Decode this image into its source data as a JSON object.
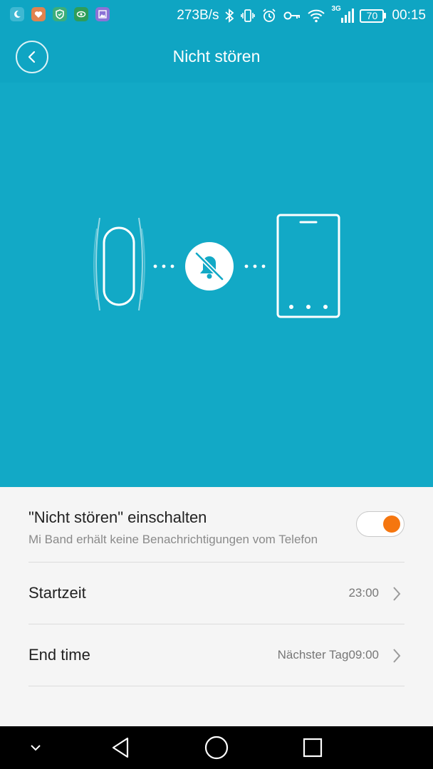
{
  "status_bar": {
    "apps": [
      {
        "icon": "moon-app-icon",
        "color": "#3fb8d2"
      },
      {
        "icon": "heart-app-icon",
        "color": "#e0834f"
      },
      {
        "icon": "shield-app-icon",
        "color": "#3cae7a"
      },
      {
        "icon": "eye-app-icon",
        "color": "#2e9d59"
      },
      {
        "icon": "image-app-icon",
        "color": "#8b72d6"
      }
    ],
    "net_speed": "273B/s",
    "network_type": "3G",
    "battery": "70",
    "time": "00:15"
  },
  "header": {
    "title": "Nicht stören",
    "back_icon": "chevron-left-icon",
    "color": "#0fa5c3"
  },
  "hero": {
    "color": "#12a9c6",
    "icons": [
      "band-icon",
      "bell-off-icon",
      "phone-icon"
    ]
  },
  "settings": {
    "dnd_toggle": {
      "title": "\"Nicht stören\" einschalten",
      "subtitle": "Mi Band erhält keine Benachrichtigungen vom Telefon",
      "enabled": true,
      "accent": "#f5760f"
    },
    "start_time": {
      "label": "Startzeit",
      "value": "23:00"
    },
    "end_time": {
      "label": "End time",
      "value": "Nächster Tag09:00"
    }
  },
  "nav_bar": {
    "buttons": [
      "collapse-icon",
      "back-triangle-icon",
      "home-circle-icon",
      "recents-square-icon"
    ]
  }
}
